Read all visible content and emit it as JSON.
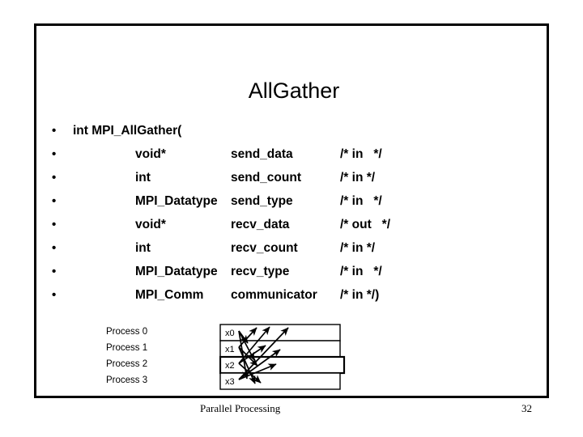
{
  "slide": {
    "title": "AllGather",
    "page_number": "32",
    "footer_title": "Parallel Processing",
    "border_color": "#000000",
    "background_color": "#ffffff",
    "text_color": "#000000"
  },
  "signature": {
    "bullet_glyph": "•",
    "lines": [
      {
        "level": 0,
        "type": "int MPI_AllGather(",
        "name": "",
        "comment": ""
      },
      {
        "level": 1,
        "type": "void*",
        "name": "send_data",
        "comment": "/* in   */"
      },
      {
        "level": 1,
        "type": "int",
        "name": "send_count",
        "comment": "/* in */"
      },
      {
        "level": 1,
        "type": "MPI_Datatype",
        "name": "send_type",
        "comment": "/* in   */"
      },
      {
        "level": 1,
        "type": "void*",
        "name": "recv_data",
        "comment": "/* out   */"
      },
      {
        "level": 1,
        "type": "int",
        "name": "recv_count",
        "comment": "/* in */"
      },
      {
        "level": 1,
        "type": "MPI_Datatype",
        "name": "recv_type",
        "comment": "/* in   */"
      },
      {
        "level": 1,
        "type": "MPI_Comm",
        "name": "communicator",
        "comment": "/* in */)"
      }
    ]
  },
  "diagram": {
    "processes": [
      {
        "label": "Process 0",
        "cell": "x0"
      },
      {
        "label": "Process 1",
        "cell": "x1"
      },
      {
        "label": "Process 2",
        "cell": "x2"
      },
      {
        "label": "Process 3",
        "cell": "x3"
      }
    ]
  }
}
